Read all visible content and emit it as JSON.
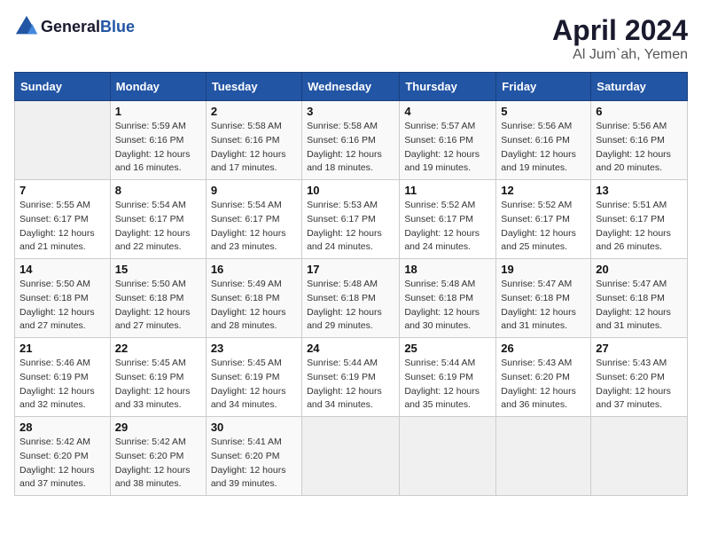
{
  "header": {
    "logo_general": "General",
    "logo_blue": "Blue",
    "month": "April 2024",
    "location": "Al Jum`ah, Yemen"
  },
  "weekdays": [
    "Sunday",
    "Monday",
    "Tuesday",
    "Wednesday",
    "Thursday",
    "Friday",
    "Saturday"
  ],
  "weeks": [
    [
      {
        "day": "",
        "info": ""
      },
      {
        "day": "1",
        "info": "Sunrise: 5:59 AM\nSunset: 6:16 PM\nDaylight: 12 hours\nand 16 minutes."
      },
      {
        "day": "2",
        "info": "Sunrise: 5:58 AM\nSunset: 6:16 PM\nDaylight: 12 hours\nand 17 minutes."
      },
      {
        "day": "3",
        "info": "Sunrise: 5:58 AM\nSunset: 6:16 PM\nDaylight: 12 hours\nand 18 minutes."
      },
      {
        "day": "4",
        "info": "Sunrise: 5:57 AM\nSunset: 6:16 PM\nDaylight: 12 hours\nand 19 minutes."
      },
      {
        "day": "5",
        "info": "Sunrise: 5:56 AM\nSunset: 6:16 PM\nDaylight: 12 hours\nand 19 minutes."
      },
      {
        "day": "6",
        "info": "Sunrise: 5:56 AM\nSunset: 6:16 PM\nDaylight: 12 hours\nand 20 minutes."
      }
    ],
    [
      {
        "day": "7",
        "info": "Sunrise: 5:55 AM\nSunset: 6:17 PM\nDaylight: 12 hours\nand 21 minutes."
      },
      {
        "day": "8",
        "info": "Sunrise: 5:54 AM\nSunset: 6:17 PM\nDaylight: 12 hours\nand 22 minutes."
      },
      {
        "day": "9",
        "info": "Sunrise: 5:54 AM\nSunset: 6:17 PM\nDaylight: 12 hours\nand 23 minutes."
      },
      {
        "day": "10",
        "info": "Sunrise: 5:53 AM\nSunset: 6:17 PM\nDaylight: 12 hours\nand 24 minutes."
      },
      {
        "day": "11",
        "info": "Sunrise: 5:52 AM\nSunset: 6:17 PM\nDaylight: 12 hours\nand 24 minutes."
      },
      {
        "day": "12",
        "info": "Sunrise: 5:52 AM\nSunset: 6:17 PM\nDaylight: 12 hours\nand 25 minutes."
      },
      {
        "day": "13",
        "info": "Sunrise: 5:51 AM\nSunset: 6:17 PM\nDaylight: 12 hours\nand 26 minutes."
      }
    ],
    [
      {
        "day": "14",
        "info": "Sunrise: 5:50 AM\nSunset: 6:18 PM\nDaylight: 12 hours\nand 27 minutes."
      },
      {
        "day": "15",
        "info": "Sunrise: 5:50 AM\nSunset: 6:18 PM\nDaylight: 12 hours\nand 27 minutes."
      },
      {
        "day": "16",
        "info": "Sunrise: 5:49 AM\nSunset: 6:18 PM\nDaylight: 12 hours\nand 28 minutes."
      },
      {
        "day": "17",
        "info": "Sunrise: 5:48 AM\nSunset: 6:18 PM\nDaylight: 12 hours\nand 29 minutes."
      },
      {
        "day": "18",
        "info": "Sunrise: 5:48 AM\nSunset: 6:18 PM\nDaylight: 12 hours\nand 30 minutes."
      },
      {
        "day": "19",
        "info": "Sunrise: 5:47 AM\nSunset: 6:18 PM\nDaylight: 12 hours\nand 31 minutes."
      },
      {
        "day": "20",
        "info": "Sunrise: 5:47 AM\nSunset: 6:18 PM\nDaylight: 12 hours\nand 31 minutes."
      }
    ],
    [
      {
        "day": "21",
        "info": "Sunrise: 5:46 AM\nSunset: 6:19 PM\nDaylight: 12 hours\nand 32 minutes."
      },
      {
        "day": "22",
        "info": "Sunrise: 5:45 AM\nSunset: 6:19 PM\nDaylight: 12 hours\nand 33 minutes."
      },
      {
        "day": "23",
        "info": "Sunrise: 5:45 AM\nSunset: 6:19 PM\nDaylight: 12 hours\nand 34 minutes."
      },
      {
        "day": "24",
        "info": "Sunrise: 5:44 AM\nSunset: 6:19 PM\nDaylight: 12 hours\nand 34 minutes."
      },
      {
        "day": "25",
        "info": "Sunrise: 5:44 AM\nSunset: 6:19 PM\nDaylight: 12 hours\nand 35 minutes."
      },
      {
        "day": "26",
        "info": "Sunrise: 5:43 AM\nSunset: 6:20 PM\nDaylight: 12 hours\nand 36 minutes."
      },
      {
        "day": "27",
        "info": "Sunrise: 5:43 AM\nSunset: 6:20 PM\nDaylight: 12 hours\nand 37 minutes."
      }
    ],
    [
      {
        "day": "28",
        "info": "Sunrise: 5:42 AM\nSunset: 6:20 PM\nDaylight: 12 hours\nand 37 minutes."
      },
      {
        "day": "29",
        "info": "Sunrise: 5:42 AM\nSunset: 6:20 PM\nDaylight: 12 hours\nand 38 minutes."
      },
      {
        "day": "30",
        "info": "Sunrise: 5:41 AM\nSunset: 6:20 PM\nDaylight: 12 hours\nand 39 minutes."
      },
      {
        "day": "",
        "info": ""
      },
      {
        "day": "",
        "info": ""
      },
      {
        "day": "",
        "info": ""
      },
      {
        "day": "",
        "info": ""
      }
    ]
  ]
}
